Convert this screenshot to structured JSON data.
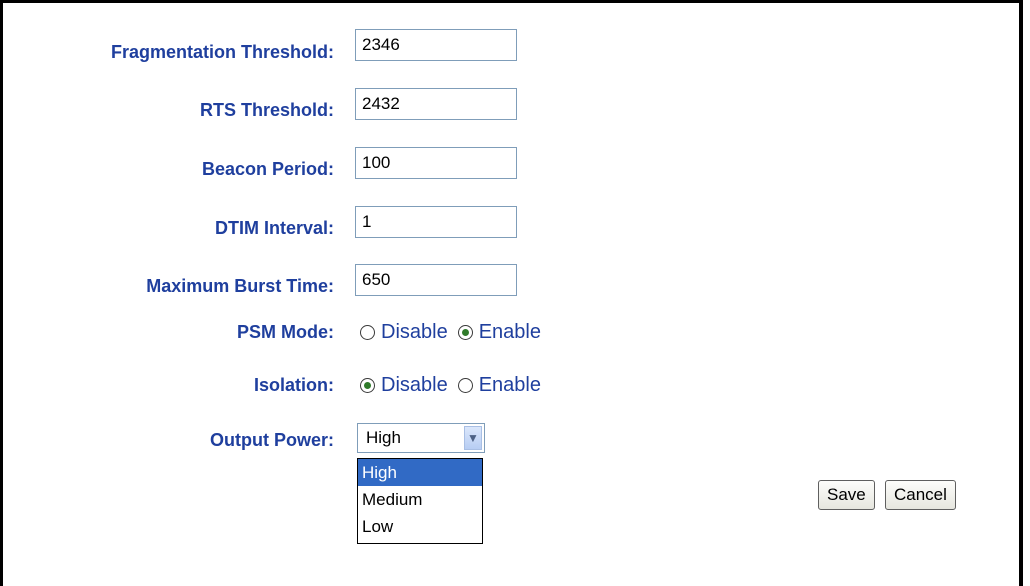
{
  "form": {
    "fragmentation": {
      "label": "Fragmentation Threshold:",
      "value": "2346"
    },
    "rts": {
      "label": "RTS Threshold:",
      "value": "2432"
    },
    "beacon": {
      "label": "Beacon Period:",
      "value": "100"
    },
    "dtim": {
      "label": "DTIM Interval:",
      "value": "1"
    },
    "burst": {
      "label": "Maximum Burst Time:",
      "value": "650"
    },
    "psm": {
      "label": "PSM Mode:",
      "disable": "Disable",
      "enable": "Enable",
      "selected": "Enable"
    },
    "isolation": {
      "label": "Isolation:",
      "disable": "Disable",
      "enable": "Enable",
      "selected": "Disable"
    },
    "output_power": {
      "label": "Output Power:",
      "selected": "High",
      "options": [
        "High",
        "Medium",
        "Low"
      ]
    }
  },
  "buttons": {
    "save": "Save",
    "cancel": "Cancel"
  },
  "colors": {
    "label": "#1f3f9e",
    "highlight": "#316ac5"
  }
}
